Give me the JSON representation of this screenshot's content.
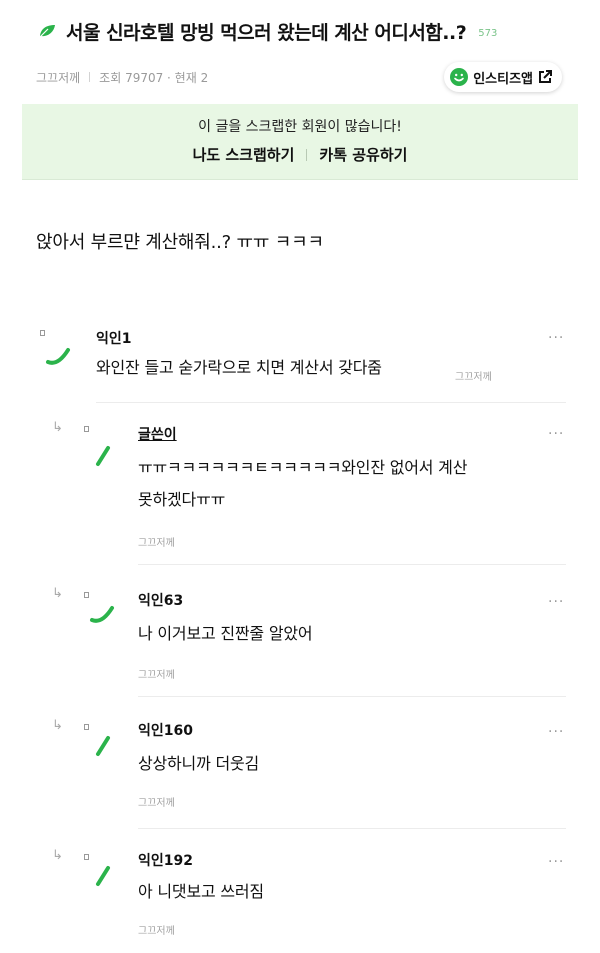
{
  "post": {
    "title": "서울 신라호텔 망빙 먹으러 왔는데 계산 어디서함..?",
    "comment_count": "573",
    "category": "그끄저께",
    "views": "조회 79707 · 현재 2",
    "app_button": "인스티즈앱",
    "body": "앉아서 부르먄 계산해줘..? ㅠㅠ ㅋㅋㅋ"
  },
  "scrap": {
    "message": "이 글을 스크랩한 회원이 많습니다!",
    "scrap_button": "나도 스크랩하기",
    "share_button": "카톡 공유하기"
  },
  "comments": [
    {
      "name": "익인1",
      "text": "와인잔 들고 숟가락으로 치면 계산서 갖다줌",
      "time": "그끄저께",
      "more": "···"
    },
    {
      "name": "글쓴이",
      "text_line1": "ㅠㅠㅋㅋㅋㅋㅋㅋㅌㅋㅋㅋㅋㅋ와인잔 없어서 계산",
      "text_line2": "못하겠다ㅠㅠ",
      "time": "그끄저께",
      "more": "···",
      "reply_arrow": "↳"
    },
    {
      "name": "익인63",
      "text": "나 이거보고 진짠줄 알았어",
      "time": "그끄저께",
      "more": "···",
      "reply_arrow": "↳"
    },
    {
      "name": "익인160",
      "text": "상상하니까 더웃김",
      "time": "그끄저께",
      "more": "···",
      "reply_arrow": "↳"
    },
    {
      "name": "익인192",
      "text": "아 니댓보고 쓰러짐",
      "time": "그끄저께",
      "more": "···",
      "reply_arrow": "↳"
    }
  ],
  "icons": {
    "leaf": "leaf-icon",
    "smile": "smile-icon",
    "external_link": "external-link-icon",
    "avatar": "avatar-stroke-icon",
    "more": "more-icon",
    "reply": "reply-arrow-icon"
  },
  "colors": {
    "accent_green": "#2bb34b",
    "scrap_bg": "#e8f7e4",
    "count_green": "#7bc48a"
  }
}
